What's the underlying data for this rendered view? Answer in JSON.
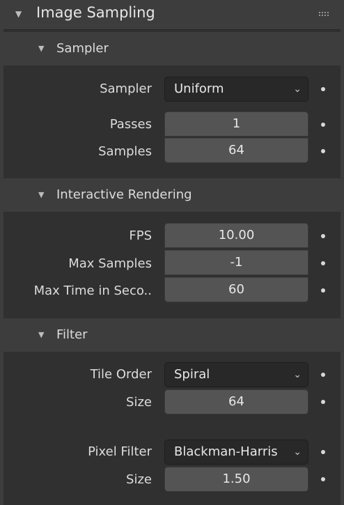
{
  "panel": {
    "title": "Image Sampling",
    "collapse_icon": "▼",
    "grip_icon": "grip-icon"
  },
  "sampler_section": {
    "title": "Sampler",
    "sampler_label": "Sampler",
    "sampler_value": "Uniform",
    "passes_label": "Passes",
    "passes_value": "1",
    "samples_label": "Samples",
    "samples_value": "64"
  },
  "interactive_section": {
    "title": "Interactive Rendering",
    "fps_label": "FPS",
    "fps_value": "10.00",
    "max_samples_label": "Max Samples",
    "max_samples_value": "-1",
    "max_time_label": "Max Time in Seco..",
    "max_time_value": "60"
  },
  "filter_section": {
    "title": "Filter",
    "tile_order_label": "Tile Order",
    "tile_order_value": "Spiral",
    "tile_size_label": "Size",
    "tile_size_value": "64",
    "pixel_filter_label": "Pixel Filter",
    "pixel_filter_value": "Blackman-Harris",
    "filter_size_label": "Size",
    "filter_size_value": "1.50"
  },
  "icons": {
    "triangle": "▼",
    "chevron": "⌄"
  }
}
